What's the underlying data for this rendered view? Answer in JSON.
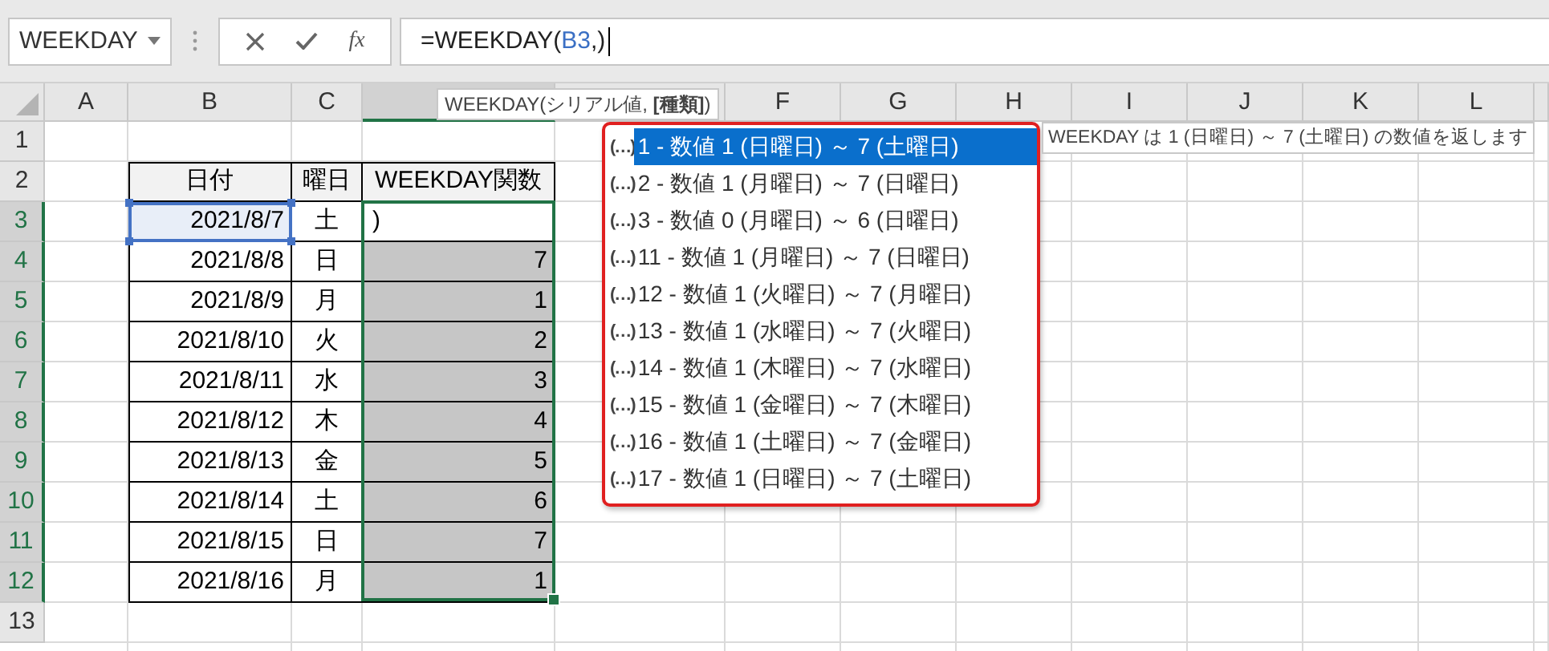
{
  "name_box": {
    "value": "WEEKDAY"
  },
  "formula_bar": {
    "insert_function_label": "fx",
    "parts": [
      {
        "text": "=WEEKDAY(",
        "kind": "plain"
      },
      {
        "text": "B3",
        "kind": "ref"
      },
      {
        "text": ",)",
        "kind": "plain"
      }
    ]
  },
  "columns": [
    {
      "label": "A",
      "selected": false
    },
    {
      "label": "B",
      "selected": false
    },
    {
      "label": "C",
      "selected": false
    },
    {
      "selected": true
    },
    {
      "selected": false
    },
    {
      "label": "F",
      "selected": false
    },
    {
      "label": "G",
      "selected": false
    },
    {
      "label": "H",
      "selected": false
    },
    {
      "label": "I",
      "selected": false
    },
    {
      "label": "J",
      "selected": false
    },
    {
      "label": "K",
      "selected": false
    },
    {
      "label": "L",
      "selected": false
    },
    {
      "selected": false
    }
  ],
  "row_headers": [
    {
      "label": "1",
      "selected": false
    },
    {
      "label": "2",
      "selected": false
    },
    {
      "label": "3",
      "selected": true
    },
    {
      "label": "4",
      "selected": true
    },
    {
      "label": "5",
      "selected": true
    },
    {
      "label": "6",
      "selected": true
    },
    {
      "label": "7",
      "selected": true
    },
    {
      "label": "8",
      "selected": true
    },
    {
      "label": "9",
      "selected": true
    },
    {
      "label": "10",
      "selected": true
    },
    {
      "label": "11",
      "selected": true
    },
    {
      "label": "12",
      "selected": true
    },
    {
      "label": "13",
      "selected": false
    }
  ],
  "table": {
    "columns": [
      "日付",
      "曜日",
      "WEEKDAY関数"
    ],
    "rows": [
      {
        "date": "2021/8/7",
        "weekday": "土",
        "value": ")",
        "referenced": true,
        "active": true
      },
      {
        "date": "2021/8/8",
        "weekday": "日",
        "value": "7",
        "referenced": false,
        "active": false
      },
      {
        "date": "2021/8/9",
        "weekday": "月",
        "value": "1",
        "referenced": false,
        "active": false
      },
      {
        "date": "2021/8/10",
        "weekday": "火",
        "value": "2",
        "referenced": false,
        "active": false
      },
      {
        "date": "2021/8/11",
        "weekday": "水",
        "value": "3",
        "referenced": false,
        "active": false
      },
      {
        "date": "2021/8/12",
        "weekday": "木",
        "value": "4",
        "referenced": false,
        "active": false
      },
      {
        "date": "2021/8/13",
        "weekday": "金",
        "value": "5",
        "referenced": false,
        "active": false
      },
      {
        "date": "2021/8/14",
        "weekday": "土",
        "value": "6",
        "referenced": false,
        "active": false
      },
      {
        "date": "2021/8/15",
        "weekday": "日",
        "value": "7",
        "referenced": false,
        "active": false
      },
      {
        "date": "2021/8/16",
        "weekday": "月",
        "value": "1",
        "referenced": false,
        "active": false
      }
    ]
  },
  "syntax_tooltip": {
    "text": "WEEKDAY(シリアル値, **[種類]**)"
  },
  "autocomplete": {
    "items": [
      {
        "marker": "(…)",
        "label": "1 - 数値 1 (日曜日) ～ 7 (土曜日)",
        "selected": true
      },
      {
        "marker": "(…)",
        "label": "2 - 数値 1 (月曜日) ～ 7 (日曜日)",
        "selected": false
      },
      {
        "marker": "(…)",
        "label": "3 - 数値 0 (月曜日) ～ 6 (日曜日)",
        "selected": false
      },
      {
        "marker": "(…)",
        "label": "11 - 数値 1 (月曜日) ～ 7 (日曜日)",
        "selected": false
      },
      {
        "marker": "(…)",
        "label": "12 - 数値 1 (火曜日) ～ 7 (月曜日)",
        "selected": false
      },
      {
        "marker": "(…)",
        "label": "13 - 数値 1 (水曜日) ～ 7 (火曜日)",
        "selected": false
      },
      {
        "marker": "(…)",
        "label": "14 - 数値 1 (木曜日) ～ 7 (水曜日)",
        "selected": false
      },
      {
        "marker": "(…)",
        "label": "15 - 数値 1 (金曜日) ～ 7 (木曜日)",
        "selected": false
      },
      {
        "marker": "(…)",
        "label": "16 - 数値 1 (土曜日) ～ 7 (金曜日)",
        "selected": false
      },
      {
        "marker": "(…)",
        "label": "17 - 数値 1 (日曜日) ～ 7 (土曜日)",
        "selected": false
      }
    ],
    "description": "WEEKDAY は 1 (日曜日) ～ 7 (土曜日) の数値を返します"
  }
}
